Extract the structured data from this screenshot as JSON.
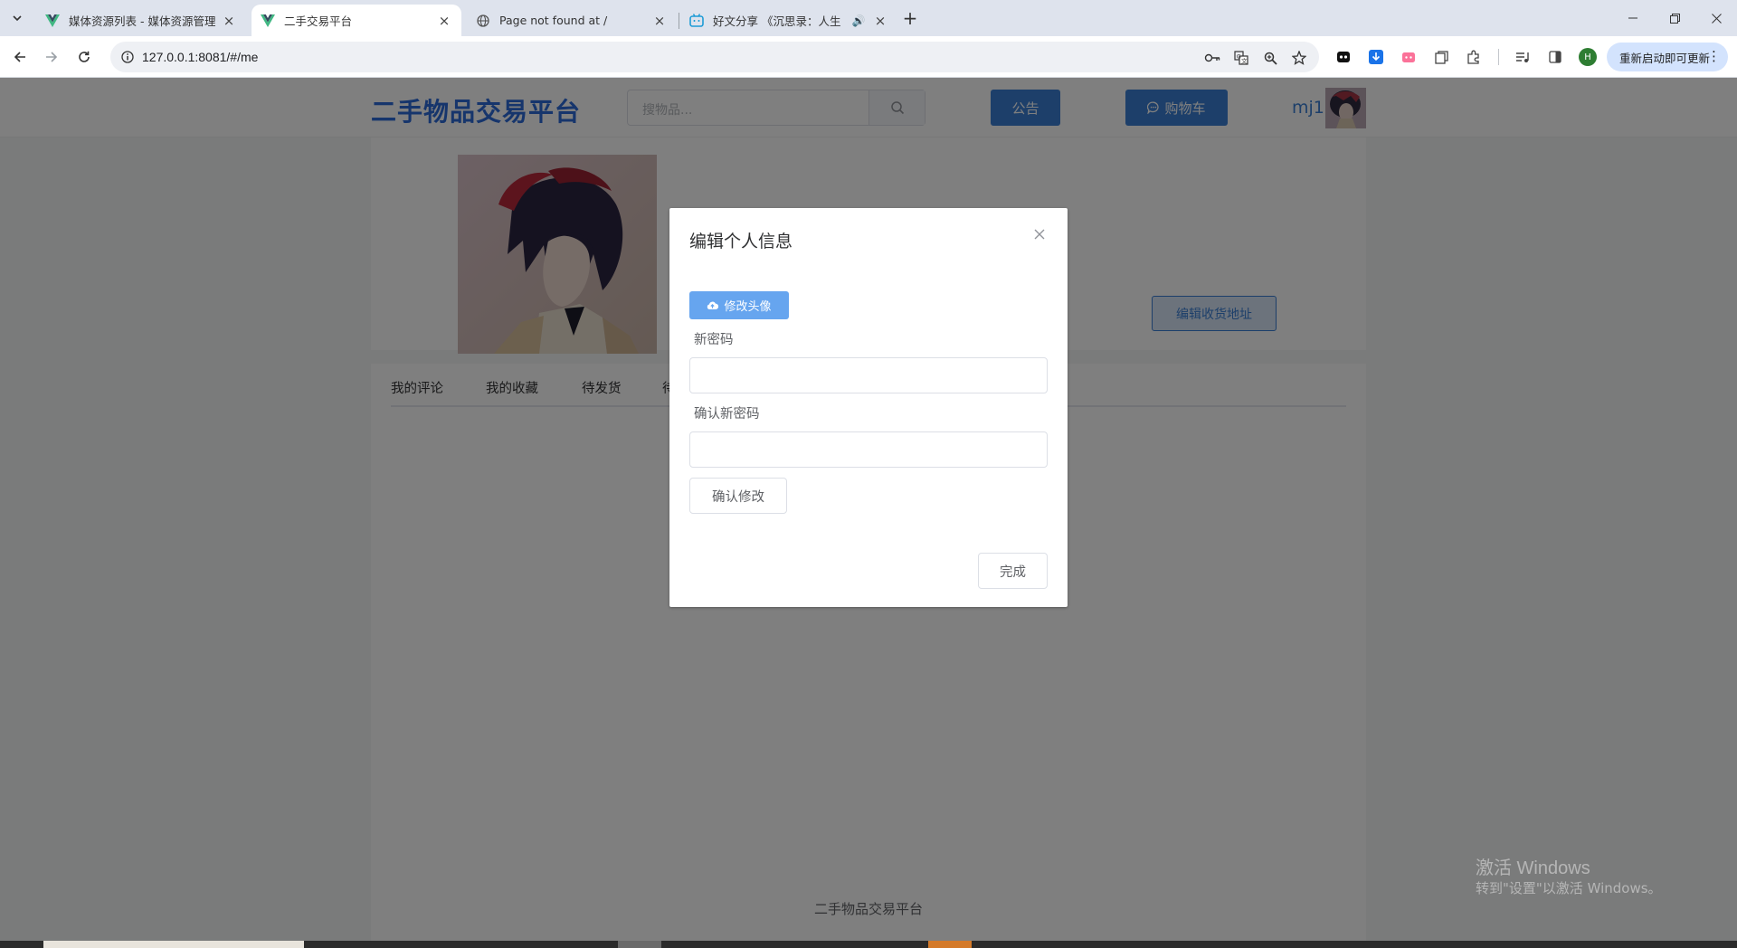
{
  "browser": {
    "tabs": [
      {
        "title": "媒体资源列表 - 媒体资源管理系",
        "icon": "vue-icon",
        "active": false
      },
      {
        "title": "二手交易平台",
        "icon": "vue-icon",
        "active": true
      },
      {
        "title": "Page not found at /",
        "icon": "globe-icon",
        "active": false
      },
      {
        "title": "好文分享 《沉思录：人生",
        "icon": "bilibili-icon",
        "active": false
      }
    ],
    "url": "127.0.0.1:8081/#/me",
    "update_button": "重新启动即可更新",
    "profile_initial": "H"
  },
  "header": {
    "logo": "二手物品交易平台",
    "search_placeholder": "搜物品...",
    "notice_label": "公告",
    "cart_label": "购物车",
    "username": "mj1"
  },
  "profile": {
    "edit_address_label": "编辑收货地址"
  },
  "tabs": [
    "我的评论",
    "我的收藏",
    "待发货",
    "待"
  ],
  "footer": "二手物品交易平台",
  "dialog": {
    "title": "编辑个人信息",
    "upload_label": "修改头像",
    "new_password_label": "新密码",
    "confirm_password_label": "确认新密码",
    "confirm_button": "确认修改",
    "done_button": "完成"
  },
  "watermark": {
    "line1": "激活 Windows",
    "line2": "转到\"设置\"以激活 Windows。"
  },
  "colors": {
    "brand": "#2c6bd9",
    "primary": "#3a7fd5",
    "upload": "#66a5ef"
  }
}
